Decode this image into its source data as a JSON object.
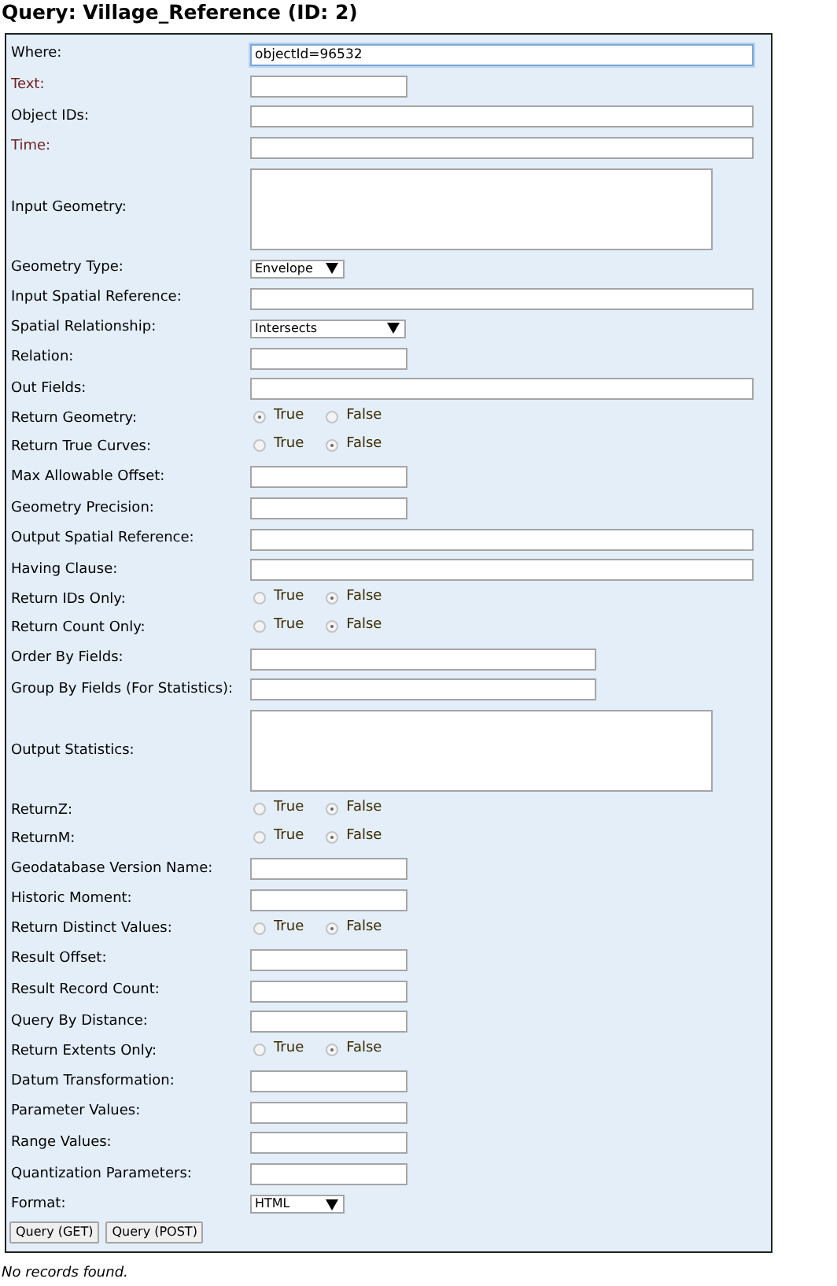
{
  "title": "Query: Village_Reference (ID: 2)",
  "fields": [
    {
      "label": "Where:",
      "kind": "longfield",
      "value": "objectId=96532",
      "focused": true
    },
    {
      "label": "Text:",
      "kind": "shortfield",
      "color": "#6e2020",
      "focused": false
    },
    {
      "label": "Object IDs:",
      "kind": "longfield",
      "focused": false
    },
    {
      "label": "Time:",
      "kind": "longfield",
      "color": "#6e2020",
      "focused": false
    },
    {
      "label": "Input Geometry:",
      "kind": "textarea"
    },
    {
      "label": "Geometry Type:",
      "kind": "dropdown",
      "value": "Envelope"
    },
    {
      "label": "Input Spatial Reference:",
      "kind": "longfield",
      "focused": false
    },
    {
      "label": "Spatial Relationship:",
      "kind": "widedropdown",
      "value": "Intersects"
    },
    {
      "label": "Relation:",
      "kind": "shortfield",
      "focused": false
    },
    {
      "label": "Out Fields:",
      "kind": "longfield",
      "focused": false
    },
    {
      "label": "Return Geometry:",
      "kind": "radio",
      "options": [
        {
          "label": "True",
          "selected": true
        },
        {
          "label": "False",
          "selected": false
        }
      ]
    },
    {
      "label": "Return True Curves:",
      "kind": "radio",
      "options": [
        {
          "label": "True",
          "selected": false
        },
        {
          "label": "False",
          "selected": true
        }
      ]
    },
    {
      "label": "Max Allowable Offset:",
      "kind": "shortfield",
      "focused": false
    },
    {
      "label": "Geometry Precision:",
      "kind": "shortfield",
      "focused": false
    },
    {
      "label": "Output Spatial Reference:",
      "kind": "longfield",
      "focused": false
    },
    {
      "label": "Having Clause:",
      "kind": "longfield",
      "focused": false
    },
    {
      "label": "Return IDs Only:",
      "kind": "radio",
      "options": [
        {
          "label": "True",
          "selected": false
        },
        {
          "label": "False",
          "selected": true
        }
      ]
    },
    {
      "label": "Return Count Only:",
      "kind": "radio",
      "options": [
        {
          "label": "True",
          "selected": false
        },
        {
          "label": "False",
          "selected": true
        }
      ]
    },
    {
      "label": "Order By Fields:",
      "kind": "midfield",
      "focused": false
    },
    {
      "label": "Group By Fields (For Statistics):",
      "kind": "midfield",
      "focused": false
    },
    {
      "label": "Output Statistics:",
      "kind": "textarea"
    },
    {
      "label": "ReturnZ:",
      "kind": "radio",
      "options": [
        {
          "label": "True",
          "selected": false
        },
        {
          "label": "False",
          "selected": true
        }
      ]
    },
    {
      "label": "ReturnM:",
      "kind": "radio",
      "options": [
        {
          "label": "True",
          "selected": false
        },
        {
          "label": "False",
          "selected": true
        }
      ]
    },
    {
      "label": "Geodatabase Version Name:",
      "kind": "shortfield",
      "focused": false
    },
    {
      "label": "Historic Moment:",
      "kind": "shortfield",
      "focused": false
    },
    {
      "label": "Return Distinct Values:",
      "kind": "radio",
      "options": [
        {
          "label": "True",
          "selected": false
        },
        {
          "label": "False",
          "selected": true
        }
      ]
    },
    {
      "label": "Result Offset:",
      "kind": "shortfield",
      "focused": false
    },
    {
      "label": "Result Record Count:",
      "kind": "shortfield",
      "focused": false
    },
    {
      "label": "Query By Distance:",
      "kind": "shortfield",
      "focused": false
    },
    {
      "label": "Return Extents Only:",
      "kind": "radio",
      "options": [
        {
          "label": "True",
          "selected": false
        },
        {
          "label": "False",
          "selected": true
        }
      ]
    },
    {
      "label": "Datum Transformation:",
      "kind": "shortfield",
      "focused": false
    },
    {
      "label": "Parameter Values:",
      "kind": "shortfield",
      "focused": false
    },
    {
      "label": "Range Values:",
      "kind": "shortfield",
      "focused": false
    },
    {
      "label": "Quantization Parameters:",
      "kind": "shortfield",
      "focused": false
    },
    {
      "label": "Format:",
      "kind": "dropdown",
      "value": "HTML"
    }
  ],
  "buttons": [
    "Query (GET)",
    "Query (POST)"
  ],
  "message": "No records found."
}
